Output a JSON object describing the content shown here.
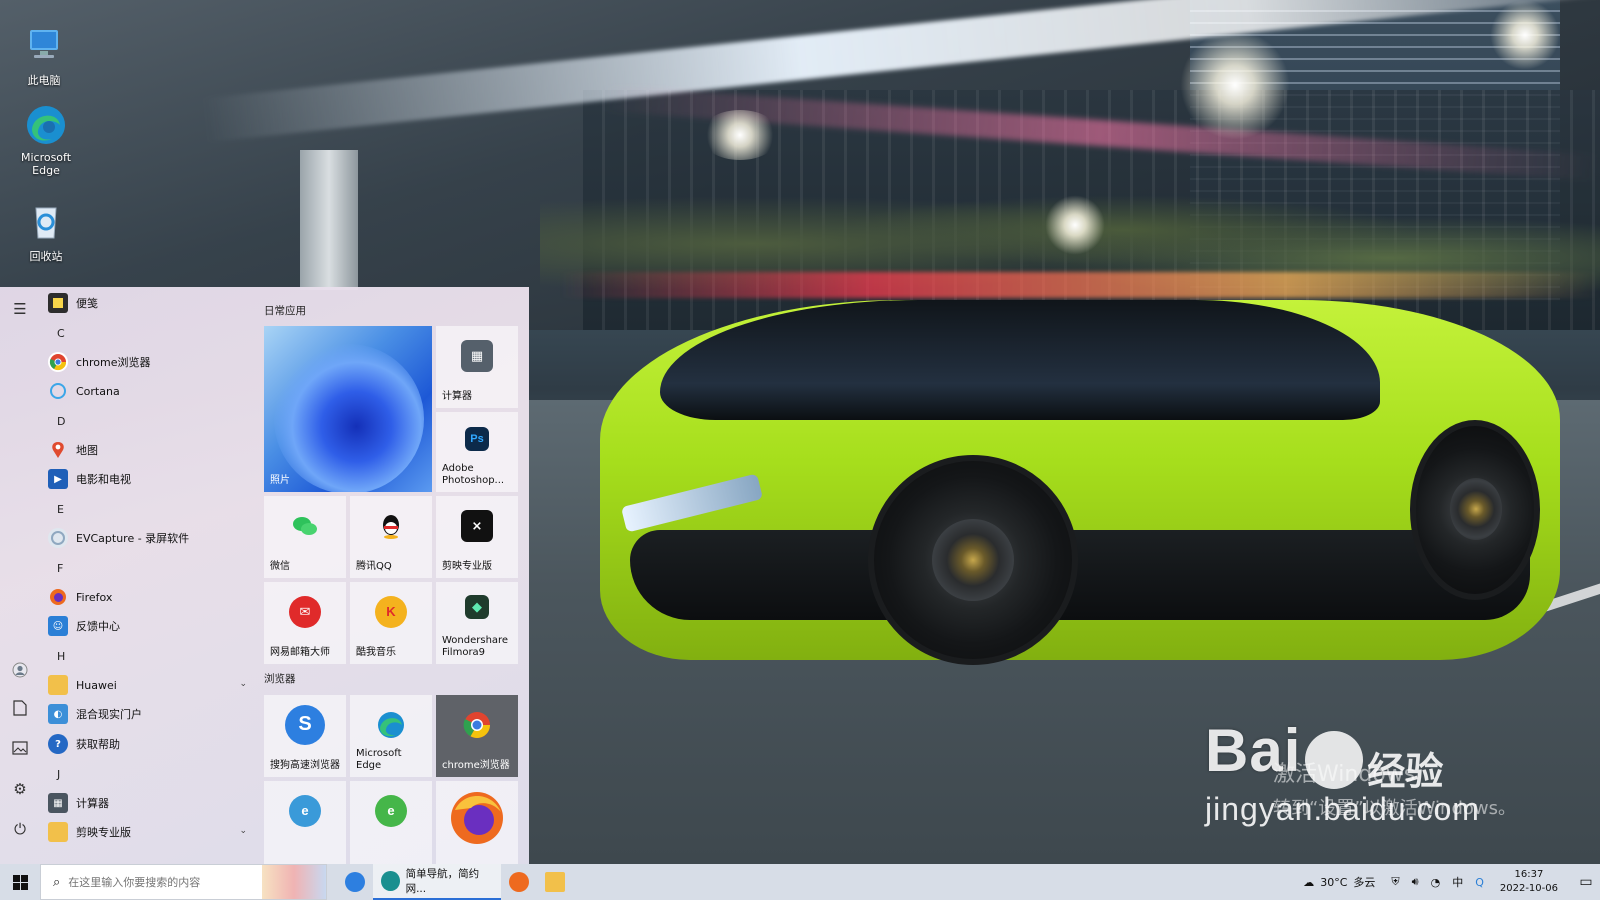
{
  "desktop": {
    "icons": [
      {
        "label": "此电脑",
        "icon": "this-pc-icon"
      },
      {
        "label": "Microsoft Edge",
        "icon": "edge-icon"
      },
      {
        "label": "回收站",
        "icon": "recycle-bin-icon"
      }
    ],
    "watermark": {
      "logo_a": "Bai",
      "logo_b": "经验",
      "url": "jingyan.baidu.com"
    },
    "activation": {
      "line1": "激活Windows",
      "line2": "转到“设置”以激活Windows。"
    }
  },
  "start_menu": {
    "rail_icons": [
      "menu-icon",
      "user-icon",
      "document-icon",
      "pictures-icon",
      "settings-icon",
      "power-icon"
    ],
    "app_list": [
      {
        "type": "app",
        "label": "便笺",
        "icon": "sticky-notes-icon",
        "color": "#2d2d2d"
      },
      {
        "type": "letter",
        "label": "C"
      },
      {
        "type": "app",
        "label": "chrome浏览器",
        "icon": "chrome-icon",
        "color": "#e0442f"
      },
      {
        "type": "app",
        "label": "Cortana",
        "icon": "cortana-icon",
        "color": "#3ba6e8"
      },
      {
        "type": "letter",
        "label": "D"
      },
      {
        "type": "app",
        "label": "地图",
        "icon": "maps-icon",
        "color": "#e04a2f"
      },
      {
        "type": "app",
        "label": "电影和电视",
        "icon": "movies-tv-icon",
        "color": "#1f5fb8"
      },
      {
        "type": "letter",
        "label": "E"
      },
      {
        "type": "app",
        "label": "EVCapture - 录屏软件",
        "icon": "evcapture-icon",
        "color": "#8fa8c0"
      },
      {
        "type": "letter",
        "label": "F"
      },
      {
        "type": "app",
        "label": "Firefox",
        "icon": "firefox-icon",
        "color": "#ee6a1f"
      },
      {
        "type": "app",
        "label": "反馈中心",
        "icon": "feedback-hub-icon",
        "color": "#2b7fd6"
      },
      {
        "type": "letter",
        "label": "H"
      },
      {
        "type": "folder",
        "label": "Huawei",
        "icon": "folder-icon",
        "color": "#f2c04a"
      },
      {
        "type": "app",
        "label": "混合现实门户",
        "icon": "mixed-reality-icon",
        "color": "#3c8fd8"
      },
      {
        "type": "app",
        "label": "获取帮助",
        "icon": "get-help-icon",
        "color": "#2468c4"
      },
      {
        "type": "letter",
        "label": "J"
      },
      {
        "type": "app",
        "label": "计算器",
        "icon": "calculator-icon",
        "color": "#4a5560"
      },
      {
        "type": "folder",
        "label": "剪映专业版",
        "icon": "folder-icon",
        "color": "#f2c04a"
      }
    ],
    "groups": [
      {
        "title": "日常应用"
      },
      {
        "title": "浏览器"
      }
    ],
    "tiles": [
      {
        "label": "照片",
        "icon": "photos-icon",
        "color": "#1d58d6"
      },
      {
        "label": "计算器",
        "icon": "calculator-icon",
        "color": "#55606b"
      },
      {
        "label": "Adobe Photoshop...",
        "icon": "photoshop-icon",
        "color": "#0c2a4a"
      },
      {
        "label": "微信",
        "icon": "wechat-icon",
        "color": "#2ec25b"
      },
      {
        "label": "腾讯QQ",
        "icon": "qq-icon",
        "color": "#1a1a1a"
      },
      {
        "label": "剪映专业版",
        "icon": "capcut-icon",
        "color": "#111111"
      },
      {
        "label": "网易邮箱大师",
        "icon": "netease-mail-icon",
        "color": "#e02a2a"
      },
      {
        "label": "酷我音乐",
        "icon": "kuwo-music-icon",
        "color": "#f4b21e"
      },
      {
        "label": "Wondershare Filmora9",
        "icon": "filmora-icon",
        "color": "#1f3b2c"
      },
      {
        "label": "搜狗高速浏览器",
        "icon": "sogou-browser-icon",
        "color": "#2d7fe0"
      },
      {
        "label": "Microsoft Edge",
        "icon": "edge-icon",
        "color": "#1a8f8f"
      },
      {
        "label": "chrome浏览器",
        "icon": "chrome-icon",
        "color": "#e0442f"
      },
      {
        "label": "",
        "icon": "browser-icon",
        "color": "#3a9ad9"
      },
      {
        "label": "",
        "icon": "browser-icon",
        "color": "#45b649"
      },
      {
        "label": "",
        "icon": "firefox-icon",
        "color": "#ee6a1f"
      }
    ]
  },
  "taskbar": {
    "search_placeholder": "在这里输入你要搜索的内容",
    "apps": [
      {
        "label": "",
        "icon": "sogou-browser-icon",
        "color": "#2d7fe0"
      },
      {
        "label": "简单导航，简约网...",
        "icon": "edge-icon",
        "color": "#1a8f8f"
      },
      {
        "label": "",
        "icon": "firefox-icon",
        "color": "#ee6a1f"
      },
      {
        "label": "",
        "icon": "file-explorer-icon",
        "color": "#f2c04a"
      }
    ],
    "weather": {
      "temp": "30°C",
      "condition": "多云"
    },
    "tray_icons": [
      "security-icon",
      "volume-icon",
      "network-icon",
      "ime-icon",
      "qq-tray-icon"
    ],
    "clock": {
      "time": "16:37",
      "date": "2022-10-06"
    }
  }
}
